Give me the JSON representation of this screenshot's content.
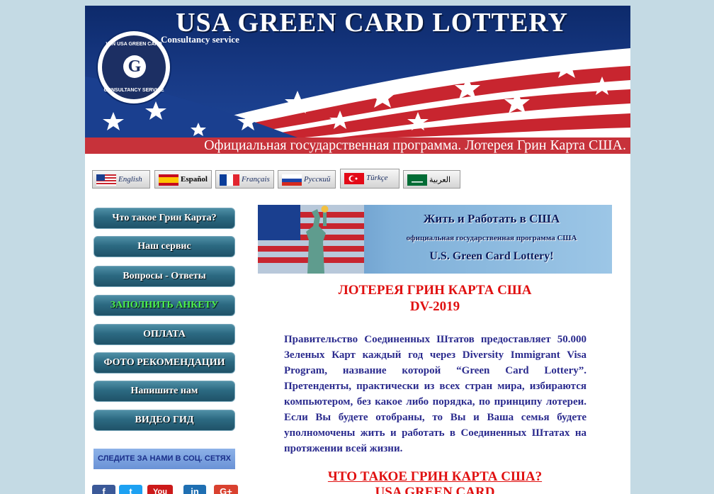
{
  "header": {
    "title": "USA GREEN CARD LOTTERY",
    "subtitle": "Consultancy service",
    "seal_top_text": "WIN USA GREEN CARD",
    "seal_letter": "G",
    "seal_bottom_text": "CONSULTANCY SERVICE",
    "marquee": "Официальная государственная программа. Лотерея Грин Карта США."
  },
  "languages": [
    {
      "label": "English",
      "flag": "us-flag-icon"
    },
    {
      "label": "Español",
      "flag": "spain-flag-icon"
    },
    {
      "label": "Français",
      "flag": "france-flag-icon"
    },
    {
      "label": "Русский",
      "flag": "russia-flag-icon"
    },
    {
      "label": "Türkçe",
      "flag": "turkey-flag-icon"
    },
    {
      "label": "العربية",
      "flag": "saudi-flag-icon"
    }
  ],
  "menu": [
    {
      "label": "Что такое Грин Карта?"
    },
    {
      "label": "Наш сервис"
    },
    {
      "label": "Вопросы - Ответы"
    },
    {
      "label": "ЗАПОЛНИТЬ АНКЕТУ"
    },
    {
      "label": "ОПЛАТА"
    },
    {
      "label": "ФОТО РЕКОМЕНДАЦИИ"
    },
    {
      "label": "Напишите нам"
    },
    {
      "label": "ВИДЕО ГИД"
    }
  ],
  "social": {
    "banner": "СЛЕДИТЕ ЗА НАМИ В СОЦ. СЕТЯХ",
    "icons": [
      {
        "name": "facebook-icon",
        "glyph": "f",
        "color": "#3b5998"
      },
      {
        "name": "twitter-icon",
        "glyph": "t",
        "color": "#1da1f2"
      },
      {
        "name": "youtube-icon",
        "glyph": "You",
        "color": "#cc1a1a"
      },
      {
        "name": "linkedin-icon",
        "glyph": "in",
        "color": "#1f6fb2"
      },
      {
        "name": "google-plus-icon",
        "glyph": "G+",
        "color": "#d9412f"
      }
    ]
  },
  "promo": {
    "line1": "Жить и Работать в США",
    "line2": "официальная государственная программа США",
    "line3": "U.S. Green Card Lottery!"
  },
  "main": {
    "title": "ЛОТЕРЕЯ ГРИН КАРТА США",
    "subtitle": "DV-2019",
    "intro": "Правительство Соединенных Штатов предоставляет 50.000 Зеленых Карт каждый год через Diversity Immigrant Visa Program, название которой “Green Card Lottery”. Претенденты, практически из всех стран мира, избираются компьютером, без какое либо порядка, по принципу лотереи. Если Вы будете отобраны, то Вы и Ваша семья будете уполномочены жить и работать в Соединенных Штатах на протяжении всей жизни.",
    "question_title": "ЧТО ТАКОЕ ГРИН КАРТА США?",
    "question_sub": "USA GREEN CARD"
  },
  "colors": {
    "page_bg": "#c4dae4",
    "header_navy": "#183a86",
    "marquee_red": "#c7323a",
    "menu_teal": "#2c6a82",
    "heading_red": "#e01010",
    "body_blue": "#2b2b8e"
  }
}
